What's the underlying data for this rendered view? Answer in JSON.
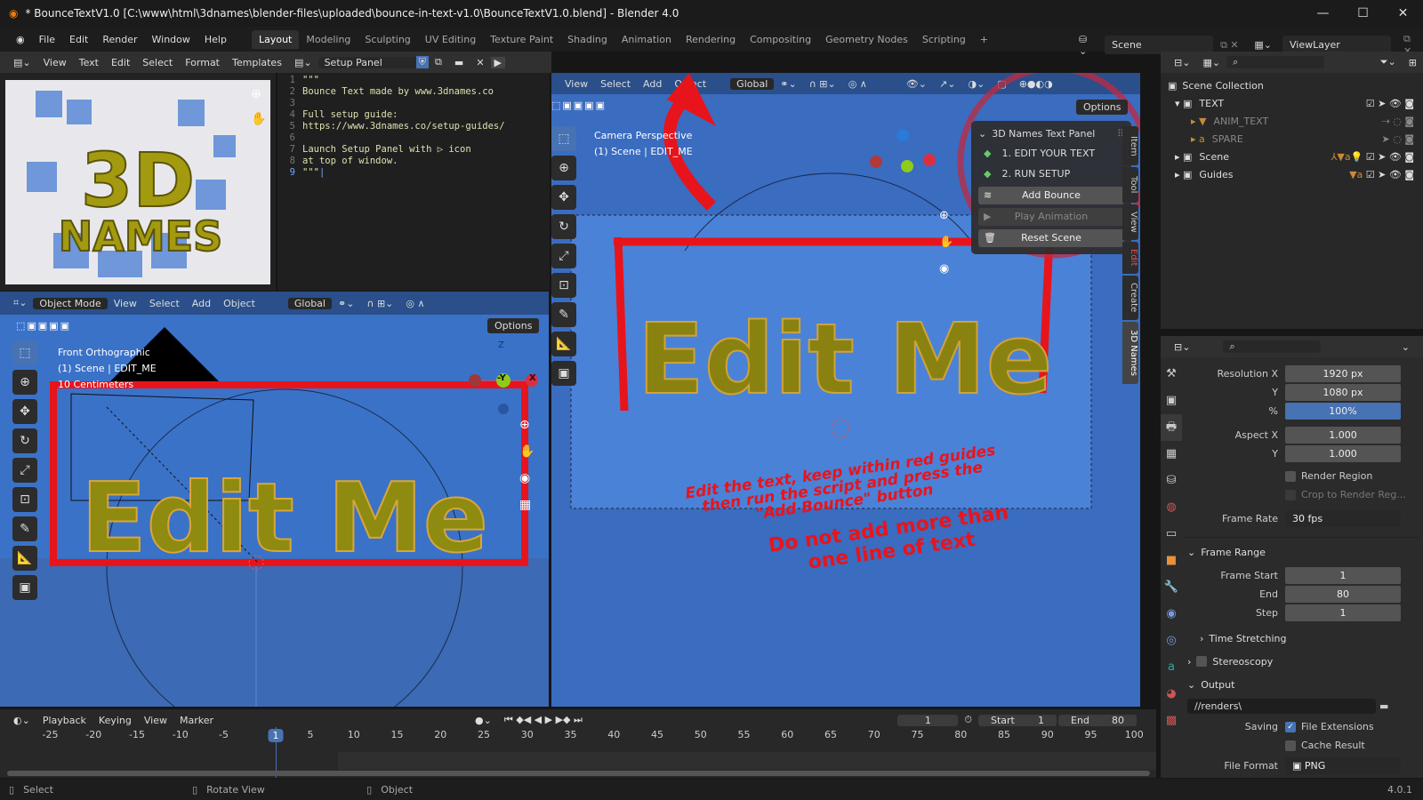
{
  "titlebar": {
    "title": "* BounceTextV1.0 [C:\\www\\html\\3dnames\\blender-files\\uploaded\\bounce-in-text-v1.0\\BounceTextV1.0.blend] - Blender 4.0",
    "minimize": "—",
    "maximize": "☐",
    "close": "✕"
  },
  "menu": {
    "items": [
      "File",
      "Edit",
      "Render",
      "Window",
      "Help"
    ],
    "workspaces": [
      "Layout",
      "Modeling",
      "Sculpting",
      "UV Editing",
      "Texture Paint",
      "Shading",
      "Animation",
      "Rendering",
      "Compositing",
      "Geometry Nodes",
      "Scripting"
    ],
    "active_workspace": "Layout",
    "add": "+",
    "scene": "Scene",
    "view_layer": "ViewLayer"
  },
  "text_editor": {
    "menus": [
      "View",
      "Text",
      "Edit",
      "Select",
      "Format",
      "Templates"
    ],
    "file": "Setup Panel",
    "run_icon": "▶",
    "lines": [
      {
        "n": "1",
        "t": "\"\"\""
      },
      {
        "n": "2",
        "t": "Bounce Text made by www.3dnames.co"
      },
      {
        "n": "3",
        "t": ""
      },
      {
        "n": "4",
        "t": "Full setup guide:"
      },
      {
        "n": "5",
        "t": "https://www.3dnames.co/setup-guides/"
      },
      {
        "n": "6",
        "t": ""
      },
      {
        "n": "7",
        "t": "Launch Setup Panel with ▷ icon"
      },
      {
        "n": "8",
        "t": "at top of window."
      },
      {
        "n": "9",
        "t": "\"\"\""
      }
    ]
  },
  "logo": {
    "text1": "3D",
    "text2": "NAMES"
  },
  "viewport_left": {
    "mode": "Object Mode",
    "menus": [
      "View",
      "Select",
      "Add",
      "Object"
    ],
    "orientation": "Global",
    "options": "Options",
    "info": [
      "Front Orthographic",
      "(1) Scene | EDIT_ME",
      "10 Centimeters"
    ],
    "text": "Edit Me",
    "axis_z": "Z",
    "axis_y": "-Y",
    "axis_x": "X"
  },
  "viewport_right": {
    "menus": [
      "View",
      "Select",
      "Add",
      "Object"
    ],
    "orientation": "Global",
    "options": "Options",
    "info": [
      "Camera Perspective",
      "(1) Scene | EDIT_ME"
    ],
    "text": "Edit Me",
    "guide1": [
      "Edit the text, keep within red guides",
      "then run the script and press the",
      "\"Add Bounce\" button"
    ],
    "guide2": [
      "Do not add more than",
      "one line of text"
    ],
    "sidebar_tabs": [
      "Item",
      "Tool",
      "View",
      "Edit",
      "Create",
      "3D Names"
    ]
  },
  "names_panel": {
    "title": "3D Names Text Panel",
    "step1": "1. EDIT YOUR TEXT",
    "step2": "2. RUN SETUP",
    "add_bounce": "Add Bounce",
    "play_animation": "Play Animation",
    "reset_scene": "Reset Scene"
  },
  "outliner": {
    "root": "Scene Collection",
    "items": [
      {
        "name": "TEXT",
        "level": 0
      },
      {
        "name": "ANIM_TEXT",
        "level": 1
      },
      {
        "name": "SPARE",
        "level": 1
      },
      {
        "name": "Scene",
        "level": 0
      },
      {
        "name": "Guides",
        "level": 0
      }
    ]
  },
  "properties": {
    "resolution_x_label": "Resolution X",
    "resolution_x": "1920 px",
    "resolution_y_label": "Y",
    "resolution_y": "1080 px",
    "percent_label": "%",
    "percent": "100%",
    "aspect_x_label": "Aspect X",
    "aspect_x": "1.000",
    "aspect_y_label": "Y",
    "aspect_y": "1.000",
    "render_region": "Render Region",
    "crop": "Crop to Render Reg...",
    "frame_rate_label": "Frame Rate",
    "frame_rate": "30 fps",
    "frame_range": "Frame Range",
    "frame_start_label": "Frame Start",
    "frame_start": "1",
    "end_label": "End",
    "end": "80",
    "step_label": "Step",
    "step": "1",
    "time_stretching": "Time Stretching",
    "stereoscopy": "Stereoscopy",
    "output": "Output",
    "output_path": "//renders\\",
    "saving_label": "Saving",
    "file_extensions": "File Extensions",
    "cache_result": "Cache Result",
    "file_format_label": "File Format",
    "file_format": "PNG"
  },
  "timeline": {
    "menus": [
      "Playback",
      "Keying",
      "View",
      "Marker"
    ],
    "current_frame": "1",
    "start_label": "Start",
    "start": "1",
    "end_label": "End",
    "end": "80",
    "ticks": [
      "-25",
      "-20",
      "-15",
      "-10",
      "-5",
      "1",
      "5",
      "10",
      "15",
      "20",
      "25",
      "30",
      "35",
      "40",
      "45",
      "50",
      "55",
      "60",
      "65",
      "70",
      "75",
      "80",
      "85",
      "90",
      "95",
      "100"
    ]
  },
  "statusbar": {
    "select": "Select",
    "rotate": "Rotate View",
    "object": "Object",
    "version": "4.0.1"
  },
  "colors": {
    "viewport": "#3a72c8",
    "accent": "#4772b3",
    "text_gold": "#8f8a10",
    "guide_red": "#e8141c"
  }
}
